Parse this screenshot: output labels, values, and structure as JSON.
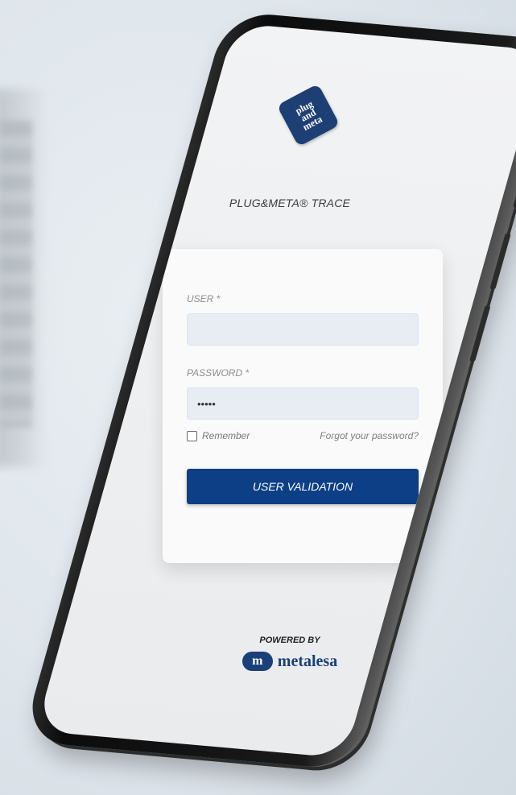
{
  "app": {
    "title": "PLUG&META® TRACE",
    "logo_text": [
      "plug",
      "and",
      "meta"
    ]
  },
  "login": {
    "user_label": "USER *",
    "user_value": "",
    "password_label": "PASSWORD *",
    "password_value": "•••••",
    "remember_label": "Remember",
    "remember_checked": false,
    "forgot_link": "Forgot your password?",
    "submit_label": "USER VALIDATION"
  },
  "footer": {
    "powered_by": "POWERED BY",
    "brand_mark": "m",
    "brand_name": "metalesa"
  },
  "colors": {
    "accent": "#0c3f86",
    "brand": "#1b3f78",
    "field_bg": "#e8edf4"
  }
}
